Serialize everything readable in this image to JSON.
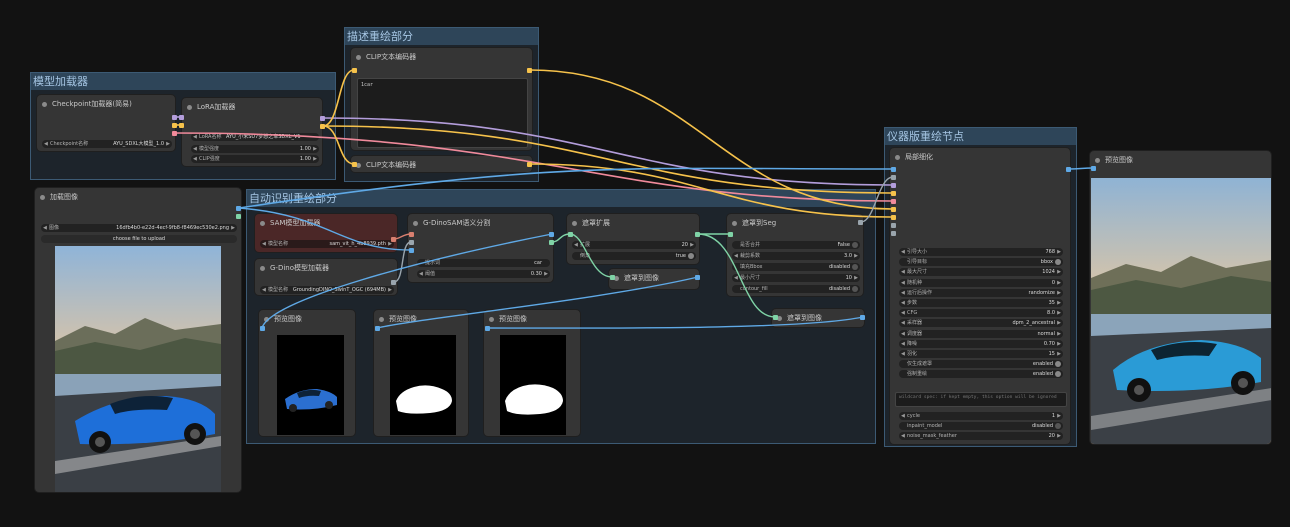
{
  "colors": {
    "clip": "#f6c24b",
    "model": "#b39ddb",
    "vae": "#f08a9b",
    "image": "#5fa9e6",
    "mask": "#7fd3a6",
    "sam": "#d87f6f",
    "misc": "#9aa5ad"
  },
  "groups": {
    "model_loader": "模型加载器",
    "desc_redraw": "描述重绘部分",
    "auto_detect": "自动识别重绘部分",
    "instrument_redraw": "仪器版重绘节点"
  },
  "checkpoint": {
    "title": "Checkpoint加载器(简易)",
    "widget_label": "Checkpoint名称",
    "widget_value": "AYU_SDXL大模型_1.0"
  },
  "lora": {
    "title": "LoRA加载器",
    "name_label": "LoRA名称",
    "name_value": "AYU_小米SU7梦想之车SDXL_V1",
    "model_strength_label": "模型强度",
    "model_strength_value": "1.00",
    "clip_strength_label": "CLIP强度",
    "clip_strength_value": "1.00"
  },
  "clip_top": {
    "title": "CLIP文本编码器",
    "text": "1car"
  },
  "clip_bottom": {
    "title": "CLIP文本编码器"
  },
  "load_image": {
    "title": "加载图像",
    "image_label": "图像",
    "image_value": "16dfb4b0-e22d-4ecf-9fb8-f8469ec530e2.png",
    "upload_button": "choose file to upload"
  },
  "sam_loader": {
    "title": "SAM模型加载器",
    "model_label": "模型名称",
    "model_value": "sam_vit_h_4b8939.pth"
  },
  "gdino_loader": {
    "title": "G-Dino模型加载器",
    "model_label": "模型名称",
    "model_value": "GroundingDINO_SwinT_OGC (694MB)"
  },
  "gdino_sam": {
    "title": "G-DinoSAM语义分割",
    "prompt_label": "提示词",
    "prompt_value": "car",
    "threshold_label": "阈值",
    "threshold_value": "0.30"
  },
  "mask_expand": {
    "title": "遮罩扩展",
    "expand_label": "扩展",
    "expand_value": "20",
    "corner_label": "倒角",
    "corner_value": "true"
  },
  "mask_to_image_1": {
    "title": "遮罩到图像"
  },
  "mask_to_seg": {
    "title": "遮罩到Seg",
    "combine_label": "是否合并",
    "combine_value": "False",
    "crop_label": "裁剪系数",
    "crop_value": "3.0",
    "bbox_label": "填充Bbox",
    "bbox_value": "disabled",
    "min_label": "最小尺寸",
    "min_value": "10",
    "contour_label": "contour_fill",
    "contour_value": "disabled"
  },
  "mask_to_image_2": {
    "title": "遮罩到图像"
  },
  "previews": [
    {
      "title": "预览图像"
    },
    {
      "title": "预览图像"
    },
    {
      "title": "预览图像"
    }
  ],
  "detailer": {
    "title": "局部细化",
    "widgets": [
      {
        "label": "引导大小",
        "value": "768",
        "kind": "num"
      },
      {
        "label": "引导目标",
        "value": "bbox",
        "kind": "toggle"
      },
      {
        "label": "最大尺寸",
        "value": "1024",
        "kind": "num"
      },
      {
        "label": "随机种",
        "value": "0",
        "kind": "num"
      },
      {
        "label": "运行后操作",
        "value": "randomize",
        "kind": "num"
      },
      {
        "label": "步数",
        "value": "35",
        "kind": "num"
      },
      {
        "label": "CFG",
        "value": "8.0",
        "kind": "num"
      },
      {
        "label": "采样器",
        "value": "dpm_2_ancestral",
        "kind": "num"
      },
      {
        "label": "调度器",
        "value": "normal",
        "kind": "num"
      },
      {
        "label": "降噪",
        "value": "0.70",
        "kind": "num"
      },
      {
        "label": "羽化",
        "value": "15",
        "kind": "num"
      },
      {
        "label": "仅生成遮罩",
        "value": "enabled",
        "kind": "toggle"
      },
      {
        "label": "强制重绘",
        "value": "enabled",
        "kind": "toggle"
      }
    ],
    "wildcard_placeholder": "wildcard spec: if kept empty, this option will be ignored",
    "widgets2": [
      {
        "label": "cycle",
        "value": "1",
        "kind": "num"
      },
      {
        "label": "inpaint_model",
        "value": "disabled",
        "kind": "toggle-off"
      },
      {
        "label": "noise_mask_feather",
        "value": "20",
        "kind": "num"
      }
    ]
  },
  "final_preview": {
    "title": "预览图像"
  }
}
